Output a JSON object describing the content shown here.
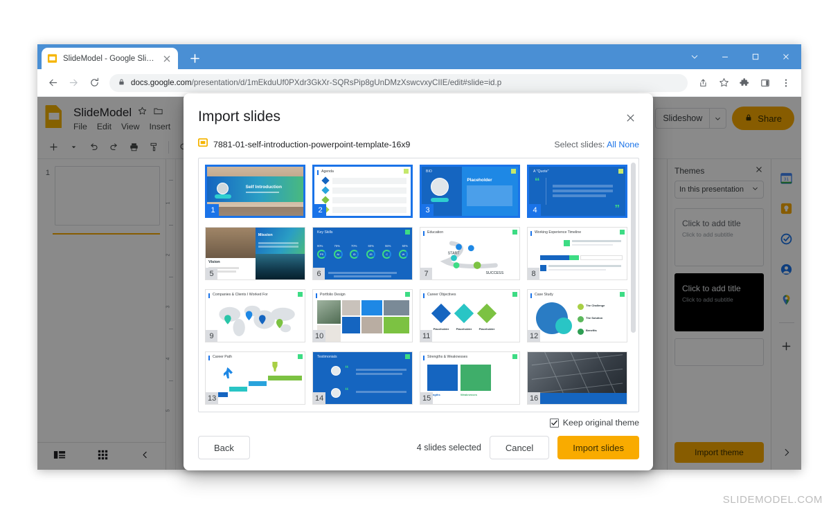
{
  "browser": {
    "tab": {
      "title": "SlideModel - Google Slides",
      "favicon": "slides-icon",
      "close": "close-icon"
    },
    "newtab_label": "+",
    "window_controls": [
      "tab-search-chevron-icon",
      "minimize-icon",
      "maximize-icon",
      "close-icon"
    ],
    "nav": {
      "back": "back-arrow-icon",
      "forward": "forward-arrow-icon",
      "reload": "reload-icon"
    },
    "omnibox": {
      "lock": "lock-icon",
      "url_domain": "docs.google.com",
      "url_path": "/presentation/d/1mEkduUf0PXdr3GkXr-SQRsPip8gUnDMzXswcvxyCIIE/edit#slide=id.p"
    },
    "actions": [
      "share-icon",
      "bookmark-star-icon",
      "extensions-puzzle-icon",
      "side-panel-icon",
      "more-menu-icon"
    ]
  },
  "slides_app": {
    "logo": "google-slides-logo",
    "doc_name": "SlideModel",
    "star": "star-icon",
    "move": "move-to-folder-icon",
    "menus": [
      "File",
      "Edit",
      "View",
      "Insert"
    ],
    "toolbar_icons": [
      "new-slide-icon",
      "new-slide-caret-icon",
      "undo-icon",
      "redo-icon",
      "print-icon",
      "paint-format-icon",
      "zoom-icon",
      "zoom-caret-icon"
    ],
    "present_label": "Slideshow",
    "present_caret": "chevron-down-icon",
    "share_label": "Share",
    "share_lock": "lock-icon",
    "filmstrip": {
      "slide_number": "1",
      "layout_icon": "filmstrip-view-icon",
      "grid_icon": "grid-view-icon",
      "collapse_icon": "chevron-left-icon"
    },
    "ruler_labels": [
      "1",
      "2",
      "3",
      "4",
      "5"
    ],
    "right_panel": {
      "title": "Themes",
      "close_icon": "close-icon",
      "select_value": "In this presentation",
      "select_caret": "chevron-down-icon",
      "themes": [
        {
          "title": "Click to add title",
          "subtitle": "Click to add subtitle",
          "style": "light"
        },
        {
          "title": "Click to add title",
          "subtitle": "Click to add subtitle",
          "style": "dark"
        },
        {
          "title": "",
          "subtitle": "",
          "style": "plain"
        }
      ],
      "import_theme_label": "Import theme"
    },
    "sidebar_icons": [
      "calendar-icon",
      "keep-icon",
      "tasks-icon",
      "contacts-icon",
      "maps-icon",
      "add-apps-icon",
      "expand-sidebar-icon"
    ]
  },
  "dialog": {
    "title": "Import slides",
    "close_icon": "close-icon",
    "file_icon": "slides-file-icon",
    "file_name": "7881-01-self-introduction-powerpoint-template-16x9",
    "select_label": "Select slides:",
    "select_all": "All",
    "select_none": "None",
    "scrollbar": "vertical-scrollbar",
    "keep_theme": {
      "label": "Keep original theme",
      "checked": true,
      "check_glyph": "✓"
    },
    "selection_count": "4 slides selected",
    "buttons": {
      "back": "Back",
      "cancel": "Cancel",
      "import": "Import slides"
    },
    "slides": [
      {
        "n": "1",
        "title": "Self Introduction",
        "selected": true,
        "kind": "title-photo"
      },
      {
        "n": "2",
        "title": "Agenda",
        "selected": true,
        "kind": "agenda"
      },
      {
        "n": "3",
        "title": "BIO",
        "selected": true,
        "kind": "bio"
      },
      {
        "n": "4",
        "title": "A \"Quote\"",
        "selected": true,
        "kind": "quote"
      },
      {
        "n": "5",
        "title": "Vision / Mission",
        "selected": false,
        "kind": "vision"
      },
      {
        "n": "6",
        "title": "Key Skills",
        "selected": false,
        "kind": "skills"
      },
      {
        "n": "7",
        "title": "Education",
        "selected": false,
        "kind": "education"
      },
      {
        "n": "8",
        "title": "Working Experience Timeline",
        "selected": false,
        "kind": "timeline"
      },
      {
        "n": "9",
        "title": "Companies & Clients I Worked For",
        "selected": false,
        "kind": "map"
      },
      {
        "n": "10",
        "title": "Portfolio Design",
        "selected": false,
        "kind": "portfolio"
      },
      {
        "n": "11",
        "title": "Career Objectives",
        "selected": false,
        "kind": "objectives"
      },
      {
        "n": "12",
        "title": "Case Study",
        "selected": false,
        "kind": "casestudy"
      },
      {
        "n": "13",
        "title": "Career Path",
        "selected": false,
        "kind": "careerpath"
      },
      {
        "n": "14",
        "title": "Testimonials",
        "selected": false,
        "kind": "testimonials"
      },
      {
        "n": "15",
        "title": "Strengths & Weaknesses",
        "selected": false,
        "kind": "strengths"
      },
      {
        "n": "16",
        "title": "",
        "selected": false,
        "kind": "photo-dark"
      }
    ],
    "skills_percents": [
      "90%",
      "75%",
      "70%",
      "60%",
      "55%",
      "50%"
    ],
    "skills_labels": [
      "PS",
      "AI",
      "ID",
      "JS",
      "C",
      "W"
    ],
    "education_labels": [
      "START",
      "SUCCESS"
    ],
    "objectives_labels": [
      "Placeholder",
      "Placeholder",
      "Placeholder"
    ],
    "casestudy_labels": [
      "The Challenge",
      "The Solution",
      "Benefits"
    ]
  },
  "watermark": "SLIDEMODEL.COM",
  "colors": {
    "chrome_blue": "#4a8fd4",
    "accent_yellow": "#f9ab00",
    "link_blue": "#1a73e8",
    "slide_blue": "#1c75d0",
    "slide_green": "#5cb85c"
  }
}
